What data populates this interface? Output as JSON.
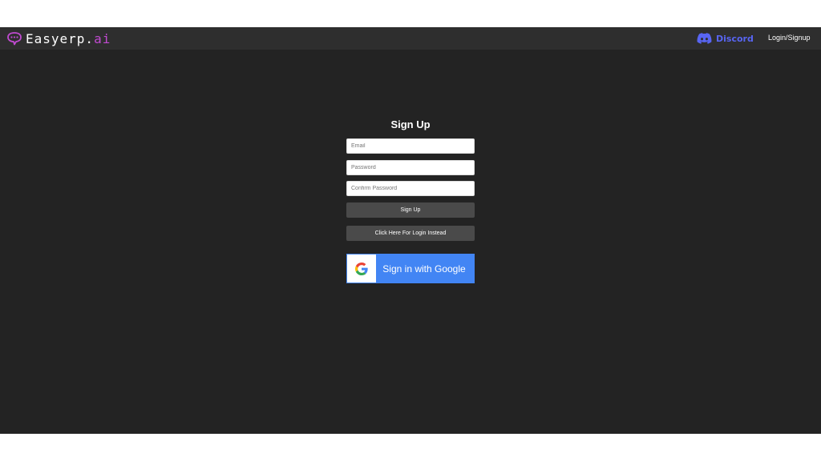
{
  "header": {
    "brand_main": "Easyerp.",
    "brand_accent": "ai",
    "discord_label": "Discord",
    "login_signup_label": "Login/Signup"
  },
  "form": {
    "title": "Sign Up",
    "email_placeholder": "Email",
    "password_placeholder": "Password",
    "confirm_placeholder": "Confirm Password",
    "signup_button": "Sign Up",
    "login_instead_button": "Click Here For Login Instead",
    "google_button": "Sign in with Google"
  },
  "icons": {
    "brand": "chat-bubble-icon",
    "discord": "discord-icon",
    "google": "google-g-icon"
  },
  "colors": {
    "background": "#232323",
    "topbar": "#2e2e2e",
    "brand_accent": "#c04ad0",
    "discord": "#5865f2",
    "button": "#4a4a4a",
    "google_blue": "#4285f4"
  }
}
